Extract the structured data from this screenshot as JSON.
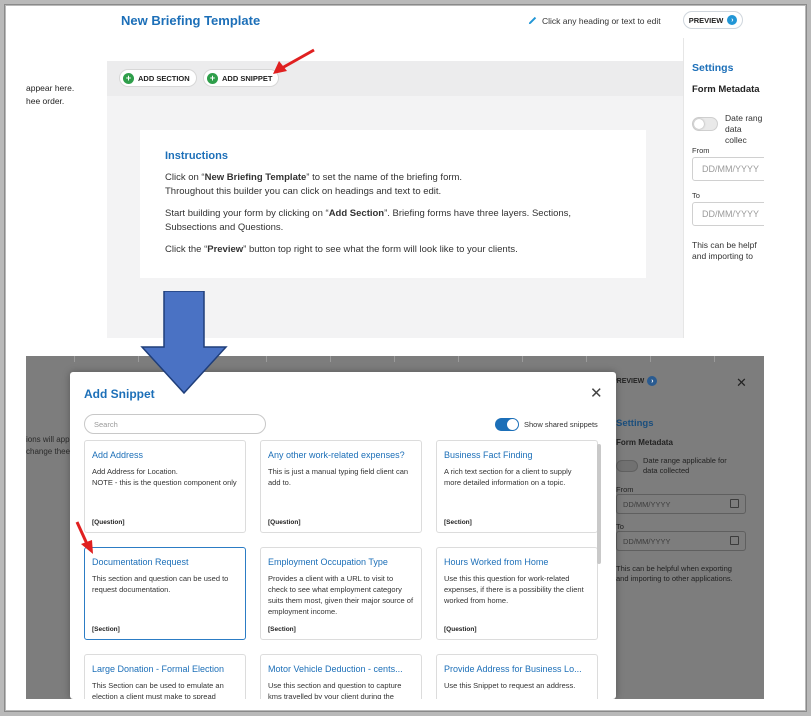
{
  "top_panel": {
    "title": "New Briefing Template",
    "edit_hint": "Click any heading or text to edit",
    "preview_label": "PREVIEW",
    "left_text_line1": "appear here.",
    "left_text_line2": "hee order.",
    "toolbar": {
      "add_section_label": "ADD SECTION",
      "add_snippet_label": "ADD SNIPPET"
    },
    "instructions": {
      "heading": "Instructions",
      "p1_pre": "Click on “",
      "p1_bold": "New Briefing Template",
      "p1_post": "” to set the name of the briefing form.",
      "p1_line2": "Throughout this builder you can click on headings and text to edit.",
      "p2_pre": "Start building your form by clicking on “",
      "p2_bold": "Add Section",
      "p2_post": "”. Briefing forms have three layers. Sections,",
      "p2_line2": "Subsections and Questions.",
      "p3_pre": "Click the “",
      "p3_bold": "Preview",
      "p3_post": "” button top right to see what the form will look like to your clients."
    },
    "settings": {
      "title": "Settings",
      "form_metadata": "Form Metadata",
      "date_range_line1": "Date rang",
      "date_range_line2": "data collec",
      "from_label": "From",
      "from_placeholder": "DD/MM/YYYY",
      "to_label": "To",
      "to_placeholder": "DD/MM/YYYY",
      "help_line1": "This can be helpf",
      "help_line2": "and importing to"
    }
  },
  "bottom_panel": {
    "bg_left_line1": "ions will app",
    "bg_left_line2": "change thee",
    "bg_preview_label": "PREVIEW",
    "bg_settings": {
      "title": "Settings",
      "form_metadata": "Form Metadata",
      "date_range_line1": "Date range applicable for",
      "date_range_line2": "data collected",
      "from_label": "From",
      "from_placeholder": "DD/MM/YYYY",
      "to_label": "To",
      "to_placeholder": "DD/MM/YYYY",
      "help_line1": "This can be helpful when exporting",
      "help_line2": "and importing to other applications."
    },
    "modal": {
      "title": "Add Snippet",
      "search_placeholder": "Search",
      "show_shared_label": "Show shared snippets",
      "cards": [
        {
          "title": "Add Address",
          "desc": "Add Address for Location.\nNOTE - this is the question component only",
          "tag": "[Question]"
        },
        {
          "title": "Any other work-related expenses?",
          "desc": "This is just a manual typing field client can add to.",
          "tag": "[Question]"
        },
        {
          "title": "Business Fact Finding",
          "desc": "A rich text section for a client to supply more detailed information on a topic.",
          "tag": "[Section]"
        },
        {
          "title": "Documentation Request",
          "desc": "This section and question can be used to request documentation.",
          "tag": "[Section]"
        },
        {
          "title": "Employment Occupation Type",
          "desc": "Provides a client with a URL to visit to check to see what employment category suits them most, given their major source of employment income.",
          "tag": "[Section]"
        },
        {
          "title": "Hours Worked from Home",
          "desc": "Use this this question for work-related expenses, if there is a possibility the client worked from home.",
          "tag": "[Question]"
        },
        {
          "title": "Large Donation - Formal Election",
          "desc": "This Section can be used to emulate an election a client must make to spread",
          "tag": ""
        },
        {
          "title": "Motor Vehicle Deduction - cents...",
          "desc": "Use this section and question to capture kms travelled by your client during the",
          "tag": ""
        },
        {
          "title": "Provide Address for Business Lo...",
          "desc": "Use this Snippet to request an address.",
          "tag": ""
        }
      ]
    }
  },
  "colors": {
    "accent": "#1c6fb8",
    "plus_green": "#2e9e4a",
    "big_arrow": "#4a72c4",
    "red_arrow": "#e02020"
  }
}
